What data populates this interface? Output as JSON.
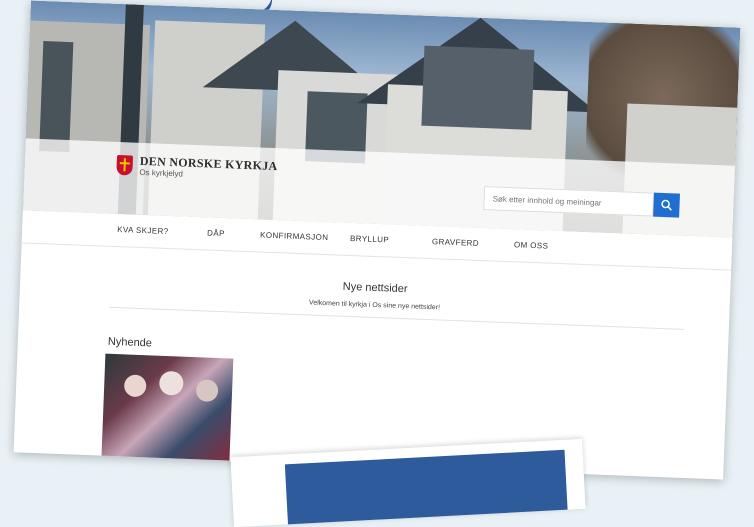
{
  "header": {
    "org_name": "DEN NORSKE KYRKJA",
    "parish": "Os kyrkjelyd",
    "search_placeholder": "Søk etter innhold og meiningar",
    "search_icon": "magnifier-icon"
  },
  "nav": {
    "items": [
      {
        "label": "KVA SKJER?"
      },
      {
        "label": "DÅP"
      },
      {
        "label": "KONFIRMASJON"
      },
      {
        "label": "BRYLLUP"
      },
      {
        "label": "GRAVFERD"
      },
      {
        "label": "OM OSS"
      }
    ]
  },
  "main": {
    "title": "Nye nettsider",
    "subtitle": "Velkomen til kyrkja i Os sine nye nettsider!",
    "news_heading": "Nyhende"
  },
  "colors": {
    "accent": "#1f6fd1",
    "logo_red": "#c8102e",
    "logo_gold": "#f4c400",
    "card_blue": "#2d5b9b"
  }
}
